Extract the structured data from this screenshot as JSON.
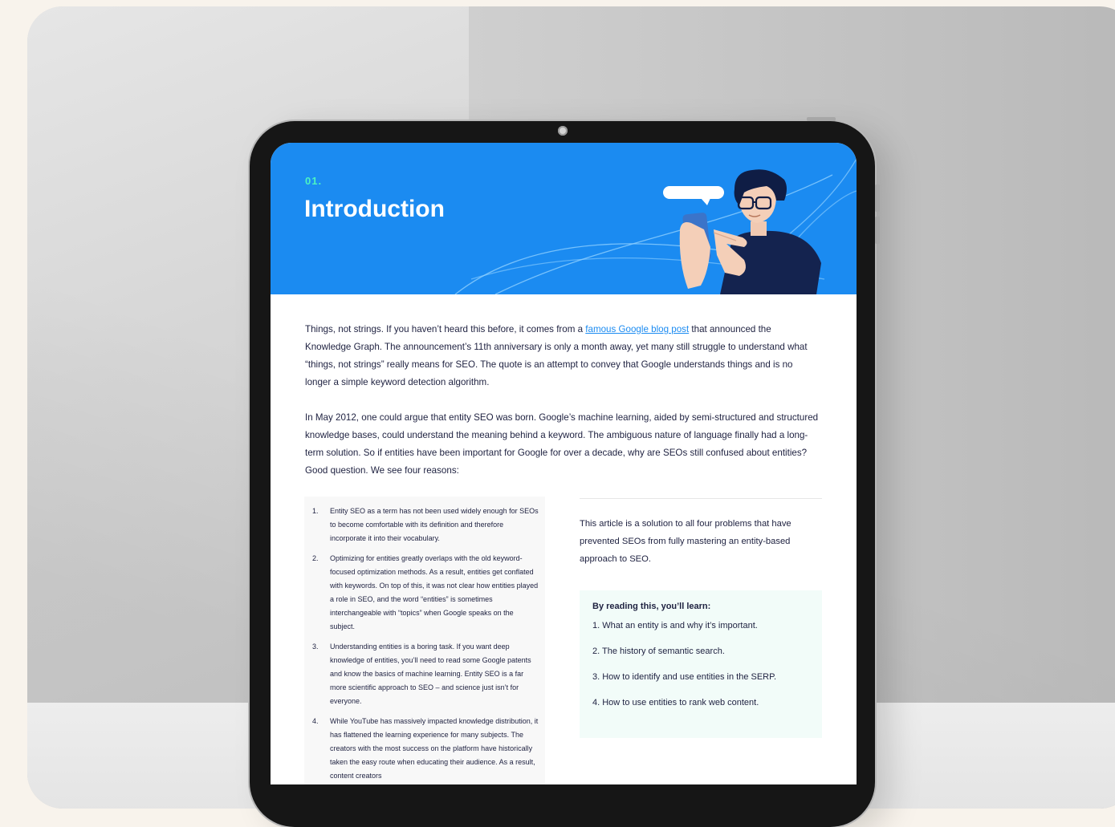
{
  "section": {
    "number": "01.",
    "title": "Introduction"
  },
  "intro": {
    "p1_before": "Things, not strings. If you haven’t heard this before, it comes from a ",
    "p1_link": "famous Google blog post",
    "p1_after": " that announced the Knowledge Graph. The announcement’s 11th anniversary is only a month away, yet many still struggle to understand what “things, not strings” really means for SEO. The quote is an attempt to convey that Google understands things and is no longer a simple keyword detection algorithm.",
    "p2": "In May 2012, one could argue that entity SEO was born. Google’s machine learning, aided by semi-structured and structured knowledge bases, could understand the meaning behind a keyword. The ambiguous nature of language finally had a long-term solution. So if entities have been important for Google for over a decade, why are SEOs still confused about entities? Good question. We see four reasons:"
  },
  "reasons": [
    {
      "num": "1.",
      "text": "Entity SEO as a term has not been used widely enough for SEOs to become comfortable with its definition and therefore incorporate it into their vocabulary."
    },
    {
      "num": "2.",
      "text": "Optimizing for entities greatly overlaps with the old keyword-focused optimization methods. As a result, entities get conflated with keywords. On top of this, it was not clear how entities played a role in SEO, and the word “entities” is sometimes interchangeable with “topics” when Google speaks on the subject."
    },
    {
      "num": "3.",
      "text": "Understanding entities is a boring task. If you want deep knowledge of entities, you’ll need to read some Google patents and know the basics of machine learning. Entity SEO is a far more scientific approach to SEO – and science just isn’t for everyone."
    },
    {
      "num": "4.",
      "text": "While YouTube has massively impacted knowledge distribution, it has flattened the learning experience for many subjects. The creators with the most success on the platform have historically taken the easy route when educating their audience. As a result, content creators"
    }
  ],
  "solution_text": "This article is a solution to all four problems that have prevented SEOs from fully mastering an entity-based approach to SEO.",
  "learn": {
    "title": "By reading this, you’ll learn:",
    "items": [
      "1.  What an entity is and why it’s important.",
      "2. The history of semantic search.",
      "3. How to identify and use entities in the SERP.",
      "4. How to use entities to rank web content."
    ]
  },
  "colors": {
    "hero_blue": "#1b8bf1",
    "accent_mint": "#4cf3c2",
    "text_navy": "#1e2140",
    "link_blue": "#1b8bf1",
    "learn_box_bg": "#f2fcf9"
  }
}
